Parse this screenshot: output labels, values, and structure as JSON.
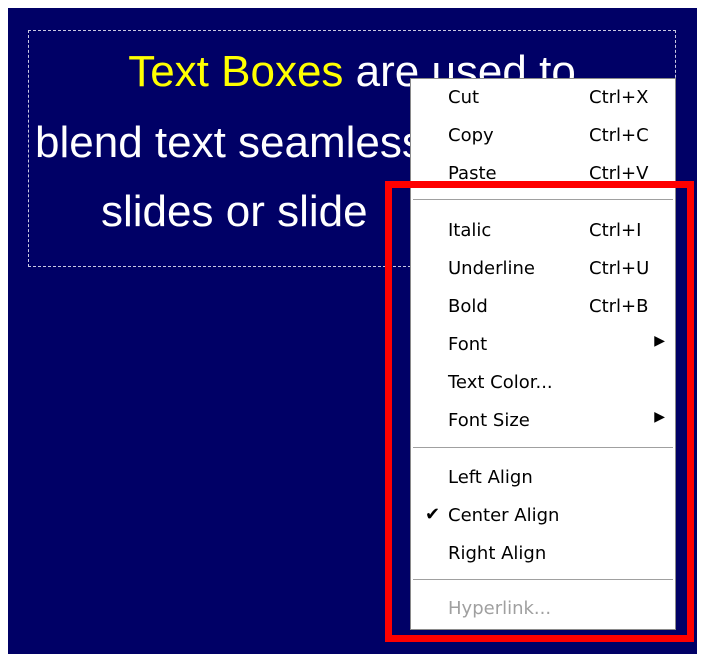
{
  "slide": {
    "line1_highlight": "Text Boxes",
    "line1_rest": " are used to",
    "line2": "blend text seamlessly into",
    "line3": "slides or slide"
  },
  "context_menu": {
    "cut": {
      "label": "Cut",
      "shortcut": "Ctrl+X"
    },
    "copy": {
      "label": "Copy",
      "shortcut": "Ctrl+C"
    },
    "paste": {
      "label": "Paste",
      "shortcut": "Ctrl+V"
    },
    "italic": {
      "label": "Italic",
      "shortcut": "Ctrl+I"
    },
    "underline": {
      "label": "Underline",
      "shortcut": "Ctrl+U"
    },
    "bold": {
      "label": "Bold",
      "shortcut": "Ctrl+B"
    },
    "font": {
      "label": "Font",
      "arrow": "▶"
    },
    "text_color": {
      "label": "Text Color..."
    },
    "font_size": {
      "label": "Font Size",
      "arrow": "▶"
    },
    "left_align": {
      "label": "Left Align"
    },
    "center_align": {
      "label": "Center Align",
      "check": "✔"
    },
    "right_align": {
      "label": "Right Align"
    },
    "hyperlink": {
      "label": "Hyperlink..."
    }
  },
  "colors": {
    "slide_background": "#000066",
    "highlight_text": "#ffff00",
    "annotation_box": "#ff0000"
  }
}
